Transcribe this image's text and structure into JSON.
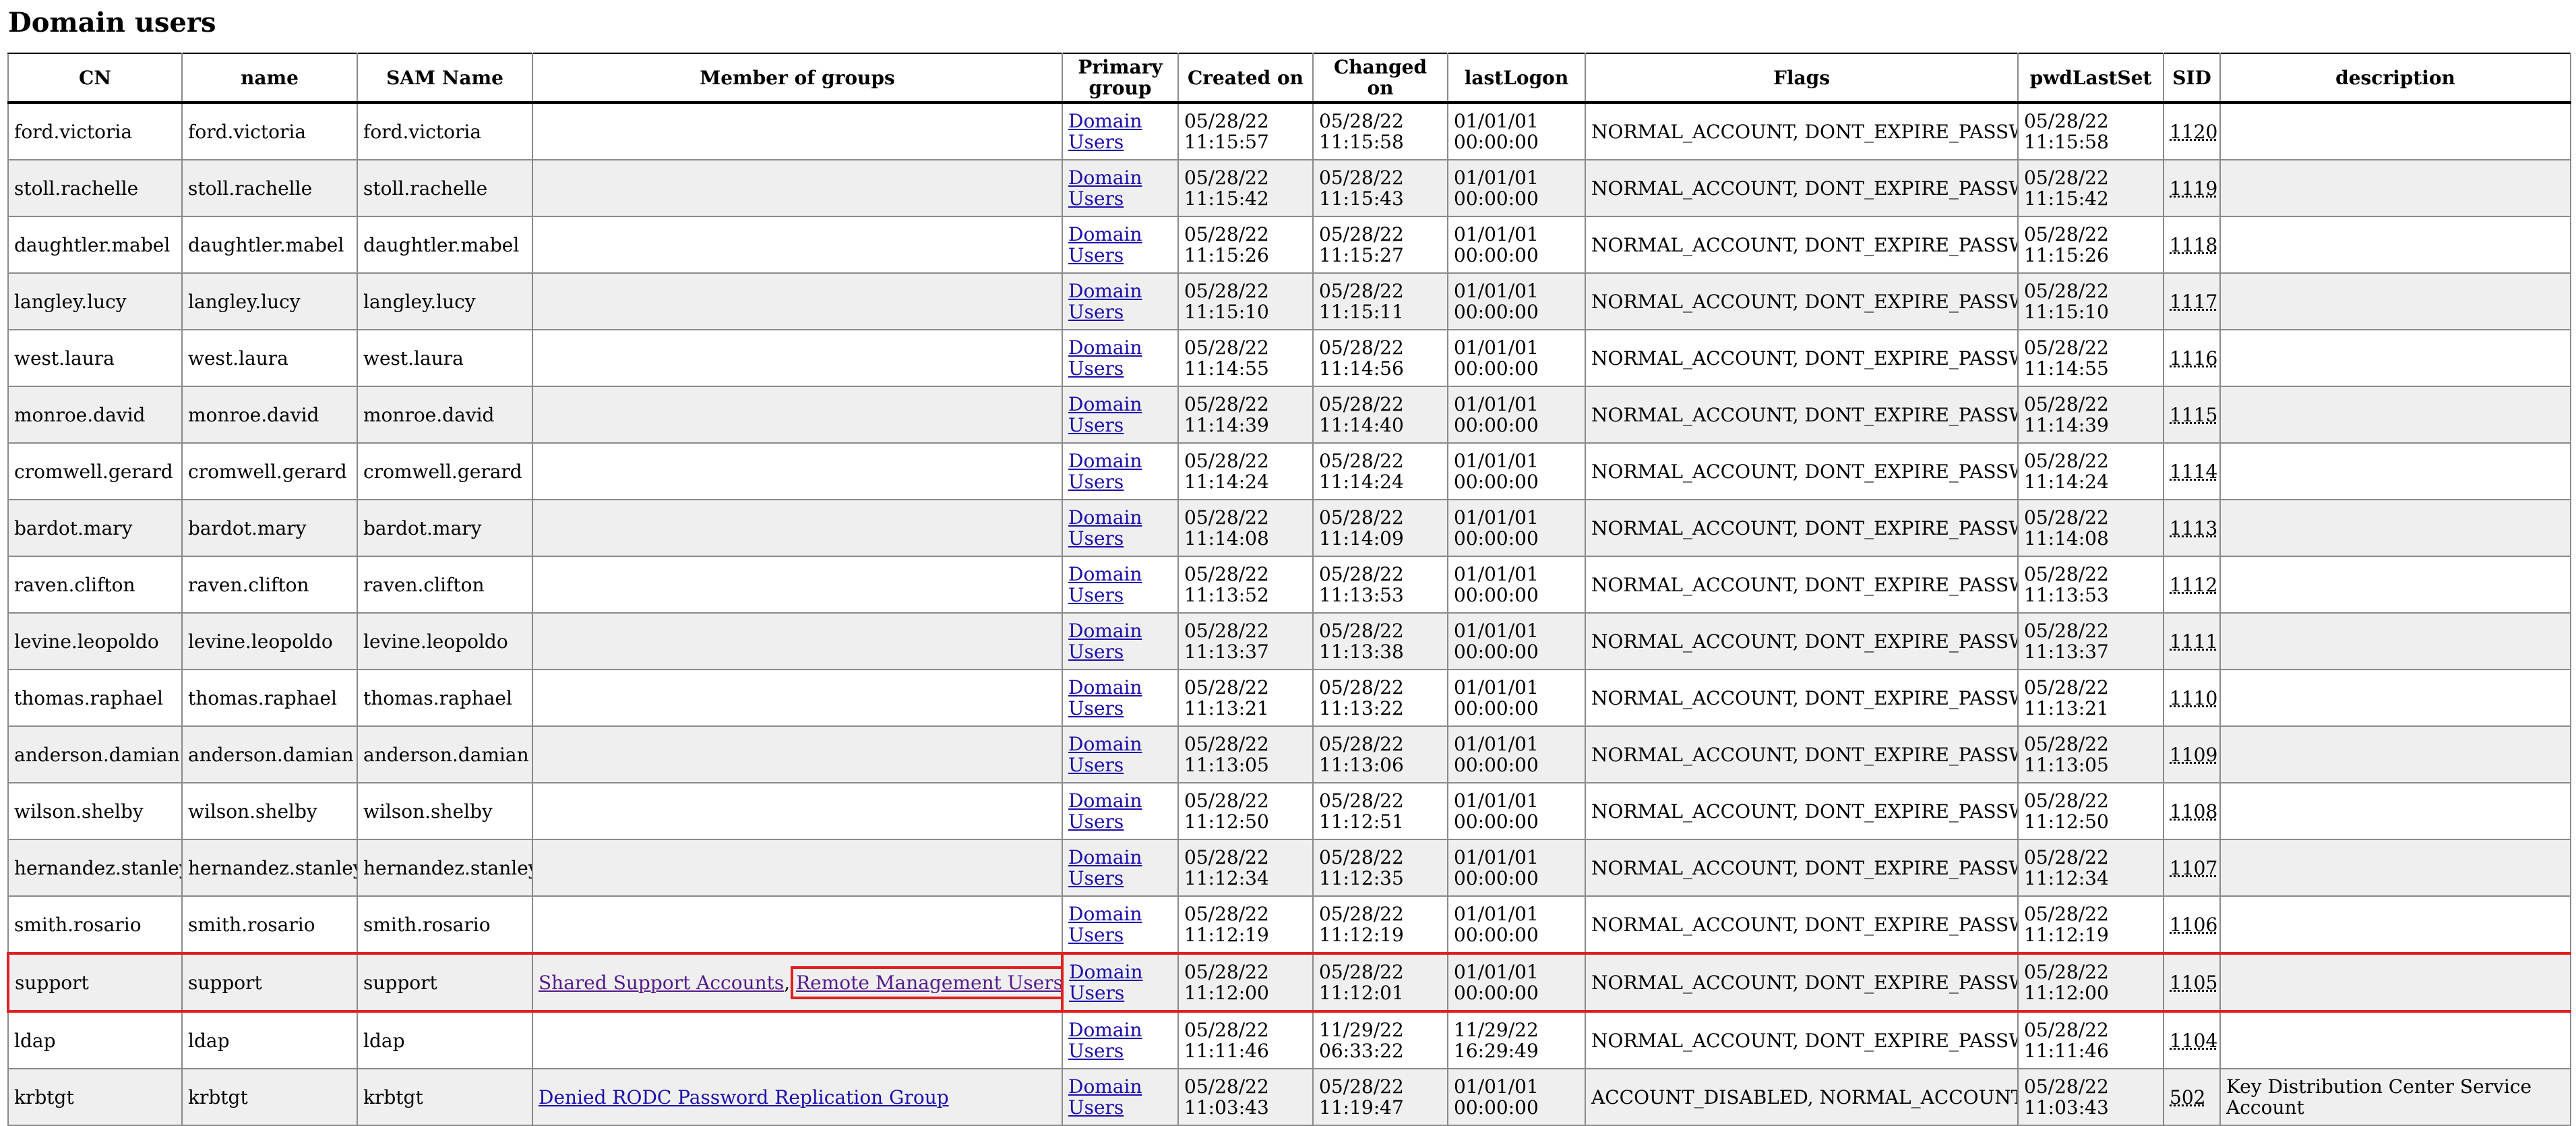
{
  "page": {
    "title": "Domain users"
  },
  "columns": [
    "CN",
    "name",
    "SAM Name",
    "Member of groups",
    "Primary group",
    "Created on",
    "Changed on",
    "lastLogon",
    "Flags",
    "pwdLastSet",
    "SID",
    "description"
  ],
  "primary_group_label": "Domain Users",
  "rows": [
    {
      "cn": "ford.victoria",
      "name": "ford.victoria",
      "sam": "ford.victoria",
      "groups": [],
      "created": "05/28/22 11:15:57",
      "changed": "05/28/22 11:15:58",
      "lastlogon": "01/01/01 00:00:00",
      "flags": "NORMAL_ACCOUNT, DONT_EXPIRE_PASSWD",
      "pwdlastset": "05/28/22 11:15:58",
      "sid": "1120",
      "description": ""
    },
    {
      "cn": "stoll.rachelle",
      "name": "stoll.rachelle",
      "sam": "stoll.rachelle",
      "groups": [],
      "created": "05/28/22 11:15:42",
      "changed": "05/28/22 11:15:43",
      "lastlogon": "01/01/01 00:00:00",
      "flags": "NORMAL_ACCOUNT, DONT_EXPIRE_PASSWD",
      "pwdlastset": "05/28/22 11:15:42",
      "sid": "1119",
      "description": ""
    },
    {
      "cn": "daughtler.mabel",
      "name": "daughtler.mabel",
      "sam": "daughtler.mabel",
      "groups": [],
      "created": "05/28/22 11:15:26",
      "changed": "05/28/22 11:15:27",
      "lastlogon": "01/01/01 00:00:00",
      "flags": "NORMAL_ACCOUNT, DONT_EXPIRE_PASSWD",
      "pwdlastset": "05/28/22 11:15:26",
      "sid": "1118",
      "description": ""
    },
    {
      "cn": "langley.lucy",
      "name": "langley.lucy",
      "sam": "langley.lucy",
      "groups": [],
      "created": "05/28/22 11:15:10",
      "changed": "05/28/22 11:15:11",
      "lastlogon": "01/01/01 00:00:00",
      "flags": "NORMAL_ACCOUNT, DONT_EXPIRE_PASSWD",
      "pwdlastset": "05/28/22 11:15:10",
      "sid": "1117",
      "description": ""
    },
    {
      "cn": "west.laura",
      "name": "west.laura",
      "sam": "west.laura",
      "groups": [],
      "created": "05/28/22 11:14:55",
      "changed": "05/28/22 11:14:56",
      "lastlogon": "01/01/01 00:00:00",
      "flags": "NORMAL_ACCOUNT, DONT_EXPIRE_PASSWD",
      "pwdlastset": "05/28/22 11:14:55",
      "sid": "1116",
      "description": ""
    },
    {
      "cn": "monroe.david",
      "name": "monroe.david",
      "sam": "monroe.david",
      "groups": [],
      "created": "05/28/22 11:14:39",
      "changed": "05/28/22 11:14:40",
      "lastlogon": "01/01/01 00:00:00",
      "flags": "NORMAL_ACCOUNT, DONT_EXPIRE_PASSWD",
      "pwdlastset": "05/28/22 11:14:39",
      "sid": "1115",
      "description": ""
    },
    {
      "cn": "cromwell.gerard",
      "name": "cromwell.gerard",
      "sam": "cromwell.gerard",
      "groups": [],
      "created": "05/28/22 11:14:24",
      "changed": "05/28/22 11:14:24",
      "lastlogon": "01/01/01 00:00:00",
      "flags": "NORMAL_ACCOUNT, DONT_EXPIRE_PASSWD",
      "pwdlastset": "05/28/22 11:14:24",
      "sid": "1114",
      "description": ""
    },
    {
      "cn": "bardot.mary",
      "name": "bardot.mary",
      "sam": "bardot.mary",
      "groups": [],
      "created": "05/28/22 11:14:08",
      "changed": "05/28/22 11:14:09",
      "lastlogon": "01/01/01 00:00:00",
      "flags": "NORMAL_ACCOUNT, DONT_EXPIRE_PASSWD",
      "pwdlastset": "05/28/22 11:14:08",
      "sid": "1113",
      "description": ""
    },
    {
      "cn": "raven.clifton",
      "name": "raven.clifton",
      "sam": "raven.clifton",
      "groups": [],
      "created": "05/28/22 11:13:52",
      "changed": "05/28/22 11:13:53",
      "lastlogon": "01/01/01 00:00:00",
      "flags": "NORMAL_ACCOUNT, DONT_EXPIRE_PASSWD",
      "pwdlastset": "05/28/22 11:13:53",
      "sid": "1112",
      "description": ""
    },
    {
      "cn": "levine.leopoldo",
      "name": "levine.leopoldo",
      "sam": "levine.leopoldo",
      "groups": [],
      "created": "05/28/22 11:13:37",
      "changed": "05/28/22 11:13:38",
      "lastlogon": "01/01/01 00:00:00",
      "flags": "NORMAL_ACCOUNT, DONT_EXPIRE_PASSWD",
      "pwdlastset": "05/28/22 11:13:37",
      "sid": "1111",
      "description": ""
    },
    {
      "cn": "thomas.raphael",
      "name": "thomas.raphael",
      "sam": "thomas.raphael",
      "groups": [],
      "created": "05/28/22 11:13:21",
      "changed": "05/28/22 11:13:22",
      "lastlogon": "01/01/01 00:00:00",
      "flags": "NORMAL_ACCOUNT, DONT_EXPIRE_PASSWD",
      "pwdlastset": "05/28/22 11:13:21",
      "sid": "1110",
      "description": ""
    },
    {
      "cn": "anderson.damian",
      "name": "anderson.damian",
      "sam": "anderson.damian",
      "groups": [],
      "created": "05/28/22 11:13:05",
      "changed": "05/28/22 11:13:06",
      "lastlogon": "01/01/01 00:00:00",
      "flags": "NORMAL_ACCOUNT, DONT_EXPIRE_PASSWD",
      "pwdlastset": "05/28/22 11:13:05",
      "sid": "1109",
      "description": ""
    },
    {
      "cn": "wilson.shelby",
      "name": "wilson.shelby",
      "sam": "wilson.shelby",
      "groups": [],
      "created": "05/28/22 11:12:50",
      "changed": "05/28/22 11:12:51",
      "lastlogon": "01/01/01 00:00:00",
      "flags": "NORMAL_ACCOUNT, DONT_EXPIRE_PASSWD",
      "pwdlastset": "05/28/22 11:12:50",
      "sid": "1108",
      "description": ""
    },
    {
      "cn": "hernandez.stanley",
      "name": "hernandez.stanley",
      "sam": "hernandez.stanley",
      "groups": [],
      "created": "05/28/22 11:12:34",
      "changed": "05/28/22 11:12:35",
      "lastlogon": "01/01/01 00:00:00",
      "flags": "NORMAL_ACCOUNT, DONT_EXPIRE_PASSWD",
      "pwdlastset": "05/28/22 11:12:34",
      "sid": "1107",
      "description": ""
    },
    {
      "cn": "smith.rosario",
      "name": "smith.rosario",
      "sam": "smith.rosario",
      "groups": [],
      "created": "05/28/22 11:12:19",
      "changed": "05/28/22 11:12:19",
      "lastlogon": "01/01/01 00:00:00",
      "flags": "NORMAL_ACCOUNT, DONT_EXPIRE_PASSWD",
      "pwdlastset": "05/28/22 11:12:19",
      "sid": "1106",
      "description": ""
    },
    {
      "cn": "support",
      "name": "support",
      "sam": "support",
      "highlight": true,
      "groups": [
        {
          "label": "Shared Support Accounts",
          "visited": true
        },
        {
          "label": "Remote Management Users",
          "visited": true,
          "boxed": true
        }
      ],
      "created": "05/28/22 11:12:00",
      "changed": "05/28/22 11:12:01",
      "lastlogon": "01/01/01 00:00:00",
      "flags": "NORMAL_ACCOUNT, DONT_EXPIRE_PASSWD",
      "pwdlastset": "05/28/22 11:12:00",
      "sid": "1105",
      "description": ""
    },
    {
      "cn": "ldap",
      "name": "ldap",
      "sam": "ldap",
      "groups": [],
      "created": "05/28/22 11:11:46",
      "changed": "11/29/22 06:33:22",
      "lastlogon": "11/29/22 16:29:49",
      "flags": "NORMAL_ACCOUNT, DONT_EXPIRE_PASSWD",
      "pwdlastset": "05/28/22 11:11:46",
      "sid": "1104",
      "description": ""
    },
    {
      "cn": "krbtgt",
      "name": "krbtgt",
      "sam": "krbtgt",
      "groups": [
        {
          "label": "Denied RODC Password Replication Group",
          "visited": false
        }
      ],
      "created": "05/28/22 11:03:43",
      "changed": "05/28/22 11:19:47",
      "lastlogon": "01/01/01 00:00:00",
      "flags": "ACCOUNT_DISABLED, NORMAL_ACCOUNT",
      "pwdlastset": "05/28/22 11:03:43",
      "sid": "502",
      "description": "Key Distribution Center Service Account"
    }
  ],
  "colors": {
    "highlight": "#e02020",
    "link": "#1a0dab",
    "visited_link": "#551a8b",
    "row_alt": "#efefef"
  }
}
